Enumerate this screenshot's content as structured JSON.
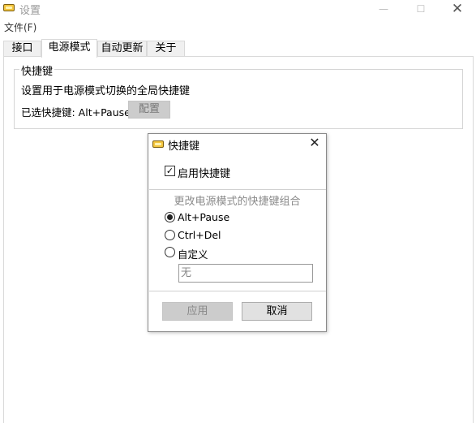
{
  "window": {
    "title": "设置",
    "icon": "keyboard-key-icon",
    "minimize_glyph": "—",
    "maximize_glyph": "☐",
    "close_glyph": "✕"
  },
  "menu": {
    "file": "文件(F)"
  },
  "tabs": [
    {
      "label": "接口"
    },
    {
      "label": "电源模式"
    },
    {
      "label": "自动更新"
    },
    {
      "label": "关于"
    }
  ],
  "active_tab": "电源模式",
  "hotkey_group": {
    "title": "快捷键",
    "description": "设置用于电源模式切换的全局快捷键",
    "current_label": "已选快捷键: Alt+Pause",
    "config_button": "配置"
  },
  "dialog": {
    "title": "快捷键",
    "close_glyph": "✕",
    "enable_checkbox": {
      "label": "启用快捷键",
      "checked": true,
      "check_glyph": "✓"
    },
    "section_title": "更改电源模式的快捷键组合",
    "options": [
      {
        "label": "Alt+Pause",
        "selected": true
      },
      {
        "label": "Ctrl+Del",
        "selected": false
      },
      {
        "label": "自定义",
        "selected": false
      }
    ],
    "custom_input_value": "无",
    "apply_button": "应用",
    "cancel_button": "取消"
  },
  "colors": {
    "icon_yellow": "#f3c53e",
    "disabled_button": "#cccccc",
    "border": "#d9d9d9"
  }
}
